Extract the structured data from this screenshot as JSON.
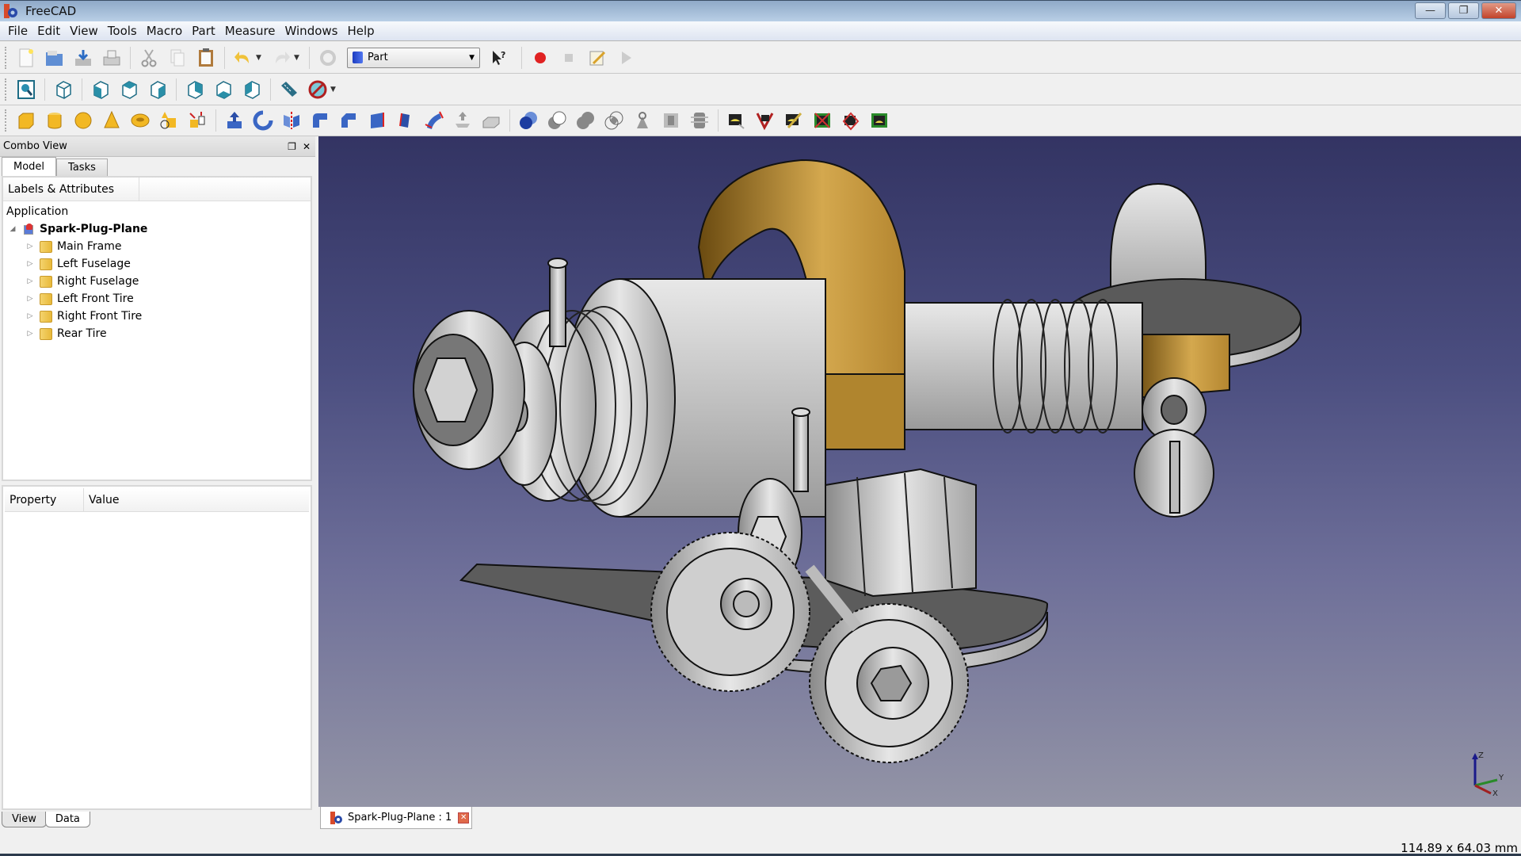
{
  "window": {
    "title": "FreeCAD",
    "controls": {
      "minimize": "—",
      "restore": "❐",
      "close": "✕"
    }
  },
  "menu": [
    "File",
    "Edit",
    "View",
    "Tools",
    "Macro",
    "Part",
    "Measure",
    "Windows",
    "Help"
  ],
  "toolbar1": {
    "file_icons": [
      "new-document-icon",
      "open-document-icon",
      "save-icon",
      "print-icon"
    ],
    "edit_icons": [
      "cut-icon",
      "copy-icon",
      "paste-icon"
    ],
    "undo_icon": "undo-icon",
    "redo_icon": "redo-icon",
    "refresh_icon": "refresh-icon",
    "workbench": "Part",
    "whats_this_icon": "whats-this-icon",
    "macro_icons": [
      "macro-record-icon",
      "macro-stop-icon",
      "macro-edit-icon",
      "macro-run-icon"
    ]
  },
  "toolbar2": {
    "icons": [
      "fit-all-icon",
      "axonometric-view-icon",
      "front-view-icon",
      "top-view-icon",
      "right-view-icon",
      "rear-view-icon",
      "bottom-view-icon",
      "left-view-icon",
      "measure-distance-icon",
      "clipping-off-icon"
    ]
  },
  "toolbar3": {
    "primitives": [
      "box-icon",
      "cylinder-icon",
      "sphere-icon",
      "cone-icon",
      "torus-icon",
      "create-primitives-icon",
      "shape-builder-icon"
    ],
    "features": [
      "extrude-icon",
      "revolve-icon",
      "mirror-icon",
      "fillet-icon",
      "chamfer-icon",
      "make-face-icon",
      "ruled-surface-icon",
      "loft-icon",
      "sweep-icon",
      "section-icon"
    ],
    "booleans": [
      "boolean-icon",
      "cut-icon",
      "fuse-icon",
      "common-icon",
      "check-geometry-icon",
      "thickness-icon",
      "cross-sections-icon"
    ],
    "measure": [
      "measure-linear-icon",
      "measure-angular-icon",
      "measure-refresh-icon",
      "clear-all-icon",
      "toggle-all-icon",
      "toggle-3d-icon"
    ]
  },
  "combo_view": {
    "title": "Combo View",
    "tabs": [
      "Model",
      "Tasks"
    ],
    "active_tab": "Model",
    "tree_header": "Labels & Attributes",
    "tree_root": "Application",
    "document": "Spark-Plug-Plane",
    "items": [
      "Main Frame",
      "Left Fuselage",
      "Right Fuselage",
      "Left Front Tire",
      "Right Front Tire",
      "Rear Tire"
    ],
    "property_headers": [
      "Property",
      "Value"
    ],
    "bottom_tabs": [
      "View",
      "Data"
    ],
    "active_bottom_tab": "Data"
  },
  "viewport": {
    "background_top": "#333463",
    "background_bottom": "#9394a6",
    "part_color_gray": "#c8c8c8",
    "part_color_gold": "#c69a3e",
    "axis_labels": [
      "Z",
      "Y",
      "X"
    ]
  },
  "document_tab": {
    "label": "Spark-Plug-Plane : 1",
    "close": "✕"
  },
  "status": {
    "dimensions": "114.89 x 64.03 mm"
  }
}
